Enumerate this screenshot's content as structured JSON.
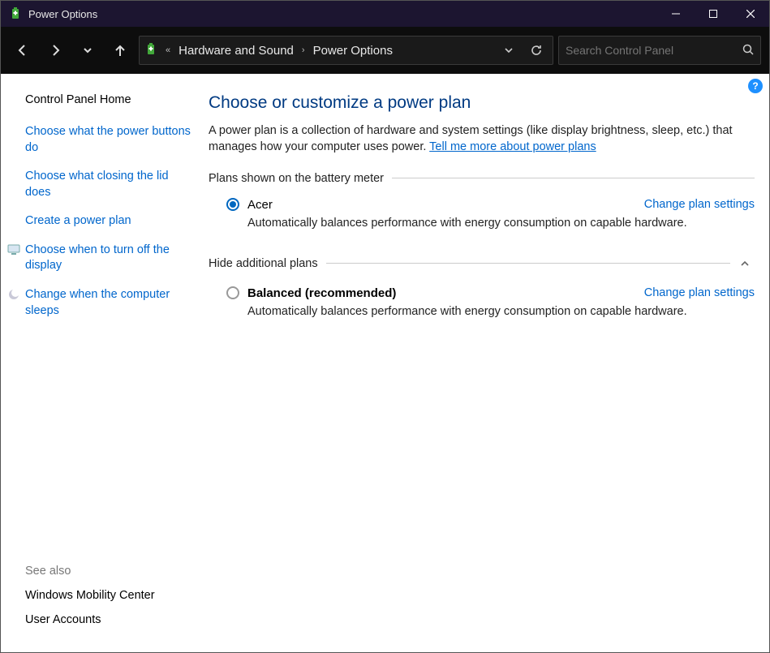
{
  "title": "Power Options",
  "breadcrumb": {
    "seg1": "Hardware and Sound",
    "seg2": "Power Options"
  },
  "search": {
    "placeholder": "Search Control Panel"
  },
  "sidebar": {
    "home": "Control Panel Home",
    "links": [
      "Choose what the power buttons do",
      "Choose what closing the lid does",
      "Create a power plan",
      "Choose when to turn off the display",
      "Change when the computer sleeps"
    ],
    "see_also_label": "See also",
    "see_also": [
      "Windows Mobility Center",
      "User Accounts"
    ]
  },
  "main": {
    "heading": "Choose or customize a power plan",
    "desc_pre": "A power plan is a collection of hardware and system settings (like display brightness, sleep, etc.) that manages how your computer uses power. ",
    "desc_link": "Tell me more about power plans",
    "group1_label": "Plans shown on the battery meter",
    "group2_label": "Hide additional plans",
    "change_label": "Change plan settings",
    "plan1": {
      "name": "Acer",
      "desc": "Automatically balances performance with energy consumption on capable hardware."
    },
    "plan2": {
      "name": "Balanced (recommended)",
      "desc": "Automatically balances performance with energy consumption on capable hardware."
    }
  },
  "help_glyph": "?"
}
